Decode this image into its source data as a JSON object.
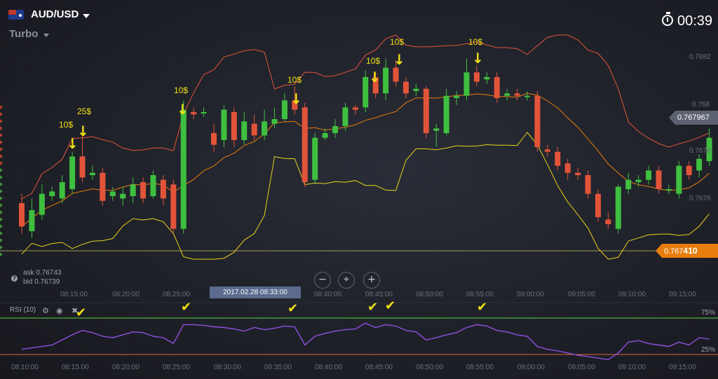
{
  "header": {
    "asset": "AUD/USD",
    "mode": "Turbo",
    "timer": "00:39",
    "flag_icon": "au-us-flag-icon",
    "timer_icon": "stopwatch-icon"
  },
  "price_axis": [
    "0.7682",
    "0.768",
    "0.7678",
    "0.7676"
  ],
  "price_tags": {
    "level": "0.767967",
    "current_prefix": "0.767",
    "current_bold": "410"
  },
  "quote": {
    "ask": "ask 0.76743",
    "bid": "bid 0.76739"
  },
  "zoom": {
    "minus": "−",
    "center": "⌖",
    "plus": "+"
  },
  "time_axis": [
    "08:10:00",
    "08:15:00",
    "08:20:00",
    "08:25:00",
    "08:30:00",
    "08:35:00",
    "08:40:00",
    "08:45:00",
    "08:50:00",
    "08:55:00",
    "09:00:00",
    "09:05:00",
    "09:10:00",
    "09:15:00"
  ],
  "time_axis_top": [
    "08:15:00",
    "08:20:00",
    "08:25:00",
    "08:40:00",
    "08:45:00",
    "08:50:00",
    "08:55:00",
    "09:00:00",
    "09:05:00",
    "09:10:00",
    "09:15:00"
  ],
  "tooltip": "2017.02.28 08:33:00",
  "rsi": {
    "label": "RSI (10)",
    "upper": "75%",
    "lower": "25%"
  },
  "annotations": [
    "10$",
    "25$",
    "10$",
    "10$",
    "10$",
    "10$",
    "10$"
  ],
  "colors": {
    "up": "#3fbf3f",
    "down": "#e2543a",
    "accent": "#e87d0d",
    "rsi": "#8f4fe0",
    "marker": "#f0e116"
  },
  "chart_data": {
    "type": "candlestick",
    "ylim": [
      0.76735,
      0.76825
    ],
    "candles": [
      {
        "o": 0.76756,
        "c": 0.76746,
        "h": 0.7676,
        "l": 0.76743,
        "t": "08:10:00"
      },
      {
        "o": 0.76744,
        "c": 0.76753,
        "h": 0.76758,
        "l": 0.76741,
        "t": "08:11:00"
      },
      {
        "o": 0.76751,
        "c": 0.7676,
        "h": 0.76764,
        "l": 0.76749,
        "t": "08:12:00"
      },
      {
        "o": 0.76759,
        "c": 0.76761,
        "h": 0.76763,
        "l": 0.76757,
        "t": "08:13:00"
      },
      {
        "o": 0.76758,
        "c": 0.76765,
        "h": 0.76768,
        "l": 0.76756,
        "t": "08:14:00"
      },
      {
        "o": 0.76762,
        "c": 0.76776,
        "h": 0.76778,
        "l": 0.7676,
        "t": "08:15:00"
      },
      {
        "o": 0.76776,
        "c": 0.76767,
        "h": 0.76785,
        "l": 0.76765,
        "t": "08:16:00"
      },
      {
        "o": 0.76768,
        "c": 0.76769,
        "h": 0.76772,
        "l": 0.76766,
        "t": "08:17:00"
      },
      {
        "o": 0.76769,
        "c": 0.76757,
        "h": 0.76771,
        "l": 0.76755,
        "t": "08:18:00"
      },
      {
        "o": 0.76759,
        "c": 0.76761,
        "h": 0.76763,
        "l": 0.76757,
        "t": "08:19:00"
      },
      {
        "o": 0.76758,
        "c": 0.7676,
        "h": 0.76763,
        "l": 0.76755,
        "t": "08:20:00"
      },
      {
        "o": 0.76759,
        "c": 0.76764,
        "h": 0.76767,
        "l": 0.76756,
        "t": "08:21:00"
      },
      {
        "o": 0.76765,
        "c": 0.76758,
        "h": 0.76767,
        "l": 0.76756,
        "t": "08:22:00"
      },
      {
        "o": 0.76759,
        "c": 0.76768,
        "h": 0.7677,
        "l": 0.76758,
        "t": "08:23:00"
      },
      {
        "o": 0.76766,
        "c": 0.76758,
        "h": 0.76768,
        "l": 0.76755,
        "t": "08:24:00"
      },
      {
        "o": 0.76764,
        "c": 0.76745,
        "h": 0.76766,
        "l": 0.76743,
        "t": "08:25:00"
      },
      {
        "o": 0.76745,
        "c": 0.76796,
        "h": 0.768,
        "l": 0.76743,
        "t": "08:26:00"
      },
      {
        "o": 0.76795,
        "c": 0.76794,
        "h": 0.76797,
        "l": 0.76792,
        "t": "08:27:00"
      },
      {
        "o": 0.76795,
        "c": 0.76795,
        "h": 0.76797,
        "l": 0.76793,
        "t": "08:28:00"
      },
      {
        "o": 0.76786,
        "c": 0.76781,
        "h": 0.7679,
        "l": 0.76778,
        "t": "08:29:00"
      },
      {
        "o": 0.76783,
        "c": 0.76796,
        "h": 0.76798,
        "l": 0.7678,
        "t": "08:30:00"
      },
      {
        "o": 0.76795,
        "c": 0.76783,
        "h": 0.76797,
        "l": 0.7678,
        "t": "08:31:00"
      },
      {
        "o": 0.76783,
        "c": 0.76791,
        "h": 0.76795,
        "l": 0.76781,
        "t": "08:32:00"
      },
      {
        "o": 0.7679,
        "c": 0.76785,
        "h": 0.76794,
        "l": 0.76783,
        "t": "08:33:00"
      },
      {
        "o": 0.76785,
        "c": 0.76791,
        "h": 0.76796,
        "l": 0.76783,
        "t": "08:34:00"
      },
      {
        "o": 0.7679,
        "c": 0.76792,
        "h": 0.76797,
        "l": 0.76788,
        "t": "08:35:00"
      },
      {
        "o": 0.76792,
        "c": 0.768,
        "h": 0.76803,
        "l": 0.76791,
        "t": "08:36:00"
      },
      {
        "o": 0.768,
        "c": 0.76796,
        "h": 0.76806,
        "l": 0.76794,
        "t": "08:37:00"
      },
      {
        "o": 0.76797,
        "c": 0.76765,
        "h": 0.76799,
        "l": 0.76763,
        "t": "08:38:00"
      },
      {
        "o": 0.76766,
        "c": 0.76784,
        "h": 0.76786,
        "l": 0.76764,
        "t": "08:39:00"
      },
      {
        "o": 0.76784,
        "c": 0.76786,
        "h": 0.76788,
        "l": 0.76783,
        "t": "08:40:00"
      },
      {
        "o": 0.76786,
        "c": 0.76789,
        "h": 0.76792,
        "l": 0.76784,
        "t": "08:41:00"
      },
      {
        "o": 0.76789,
        "c": 0.76797,
        "h": 0.76799,
        "l": 0.76787,
        "t": "08:42:00"
      },
      {
        "o": 0.76797,
        "c": 0.76796,
        "h": 0.76798,
        "l": 0.76794,
        "t": "08:43:00"
      },
      {
        "o": 0.76797,
        "c": 0.7681,
        "h": 0.76813,
        "l": 0.76795,
        "t": "08:44:00"
      },
      {
        "o": 0.7681,
        "c": 0.76803,
        "h": 0.76812,
        "l": 0.76801,
        "t": "08:45:00"
      },
      {
        "o": 0.76803,
        "c": 0.76814,
        "h": 0.76818,
        "l": 0.768,
        "t": "08:46:00"
      },
      {
        "o": 0.76814,
        "c": 0.76808,
        "h": 0.76817,
        "l": 0.76806,
        "t": "08:47:00"
      },
      {
        "o": 0.76808,
        "c": 0.76803,
        "h": 0.7681,
        "l": 0.76801,
        "t": "08:48:00"
      },
      {
        "o": 0.76804,
        "c": 0.76805,
        "h": 0.76807,
        "l": 0.76802,
        "t": "08:49:00"
      },
      {
        "o": 0.76805,
        "c": 0.76786,
        "h": 0.76806,
        "l": 0.76784,
        "t": "08:50:00"
      },
      {
        "o": 0.76787,
        "c": 0.76788,
        "h": 0.7679,
        "l": 0.7678,
        "t": "08:51:00"
      },
      {
        "o": 0.76786,
        "c": 0.76802,
        "h": 0.76805,
        "l": 0.76785,
        "t": "08:52:00"
      },
      {
        "o": 0.76801,
        "c": 0.76802,
        "h": 0.76804,
        "l": 0.76798,
        "t": "08:53:00"
      },
      {
        "o": 0.76802,
        "c": 0.76812,
        "h": 0.76818,
        "l": 0.768,
        "t": "08:54:00"
      },
      {
        "o": 0.76812,
        "c": 0.76808,
        "h": 0.76815,
        "l": 0.76806,
        "t": "08:55:00"
      },
      {
        "o": 0.76809,
        "c": 0.7681,
        "h": 0.76812,
        "l": 0.76807,
        "t": "08:56:00"
      },
      {
        "o": 0.7681,
        "c": 0.76801,
        "h": 0.76812,
        "l": 0.76799,
        "t": "08:57:00"
      },
      {
        "o": 0.76802,
        "c": 0.76803,
        "h": 0.76805,
        "l": 0.768,
        "t": "08:58:00"
      },
      {
        "o": 0.76803,
        "c": 0.76802,
        "h": 0.76805,
        "l": 0.768,
        "t": "08:59:00"
      },
      {
        "o": 0.76802,
        "c": 0.76802,
        "h": 0.76804,
        "l": 0.768,
        "t": "09:00:00"
      },
      {
        "o": 0.76802,
        "c": 0.7678,
        "h": 0.76804,
        "l": 0.76778,
        "t": "09:01:00"
      },
      {
        "o": 0.76779,
        "c": 0.76778,
        "h": 0.76781,
        "l": 0.76776,
        "t": "09:02:00"
      },
      {
        "o": 0.76778,
        "c": 0.76772,
        "h": 0.7678,
        "l": 0.7677,
        "t": "09:03:00"
      },
      {
        "o": 0.76773,
        "c": 0.76769,
        "h": 0.76775,
        "l": 0.76766,
        "t": "09:04:00"
      },
      {
        "o": 0.76769,
        "c": 0.76768,
        "h": 0.76771,
        "l": 0.76766,
        "t": "09:05:00"
      },
      {
        "o": 0.76768,
        "c": 0.7676,
        "h": 0.7677,
        "l": 0.76758,
        "t": "09:06:00"
      },
      {
        "o": 0.7676,
        "c": 0.7675,
        "h": 0.76762,
        "l": 0.76748,
        "t": "09:07:00"
      },
      {
        "o": 0.76749,
        "c": 0.76747,
        "h": 0.76752,
        "l": 0.76745,
        "t": "09:08:00"
      },
      {
        "o": 0.76745,
        "c": 0.76763,
        "h": 0.76764,
        "l": 0.76743,
        "t": "09:09:00"
      },
      {
        "o": 0.76762,
        "c": 0.76766,
        "h": 0.76769,
        "l": 0.7676,
        "t": "09:10:00"
      },
      {
        "o": 0.76765,
        "c": 0.76766,
        "h": 0.76768,
        "l": 0.76763,
        "t": "09:11:00"
      },
      {
        "o": 0.76766,
        "c": 0.7677,
        "h": 0.76772,
        "l": 0.76764,
        "t": "09:12:00"
      },
      {
        "o": 0.7677,
        "c": 0.76762,
        "h": 0.76772,
        "l": 0.7676,
        "t": "09:13:00"
      },
      {
        "o": 0.76762,
        "c": 0.76762,
        "h": 0.76764,
        "l": 0.7676,
        "t": "09:14:00"
      },
      {
        "o": 0.7676,
        "c": 0.76772,
        "h": 0.76774,
        "l": 0.76758,
        "t": "09:15:00"
      },
      {
        "o": 0.76772,
        "c": 0.76768,
        "h": 0.76774,
        "l": 0.76766,
        "t": "09:16:00"
      },
      {
        "o": 0.7677,
        "c": 0.76775,
        "h": 0.76777,
        "l": 0.76767,
        "t": "09:17:00"
      },
      {
        "o": 0.76774,
        "c": 0.76784,
        "h": 0.76788,
        "l": 0.76772,
        "t": "09:18:00"
      }
    ],
    "rsi_values": [
      32,
      34,
      36,
      38,
      45,
      52,
      58,
      55,
      50,
      48,
      52,
      56,
      55,
      50,
      48,
      40,
      66,
      66,
      65,
      63,
      62,
      60,
      57,
      62,
      59,
      61,
      64,
      63,
      38,
      50,
      54,
      57,
      59,
      60,
      68,
      62,
      66,
      64,
      58,
      56,
      45,
      48,
      52,
      55,
      62,
      66,
      64,
      58,
      56,
      52,
      50,
      36,
      32,
      30,
      27,
      24,
      22,
      20,
      18,
      27,
      42,
      44,
      40,
      38,
      36,
      42,
      38,
      48,
      46
    ],
    "rsi_levels": {
      "upper": 75,
      "lower": 25
    }
  }
}
